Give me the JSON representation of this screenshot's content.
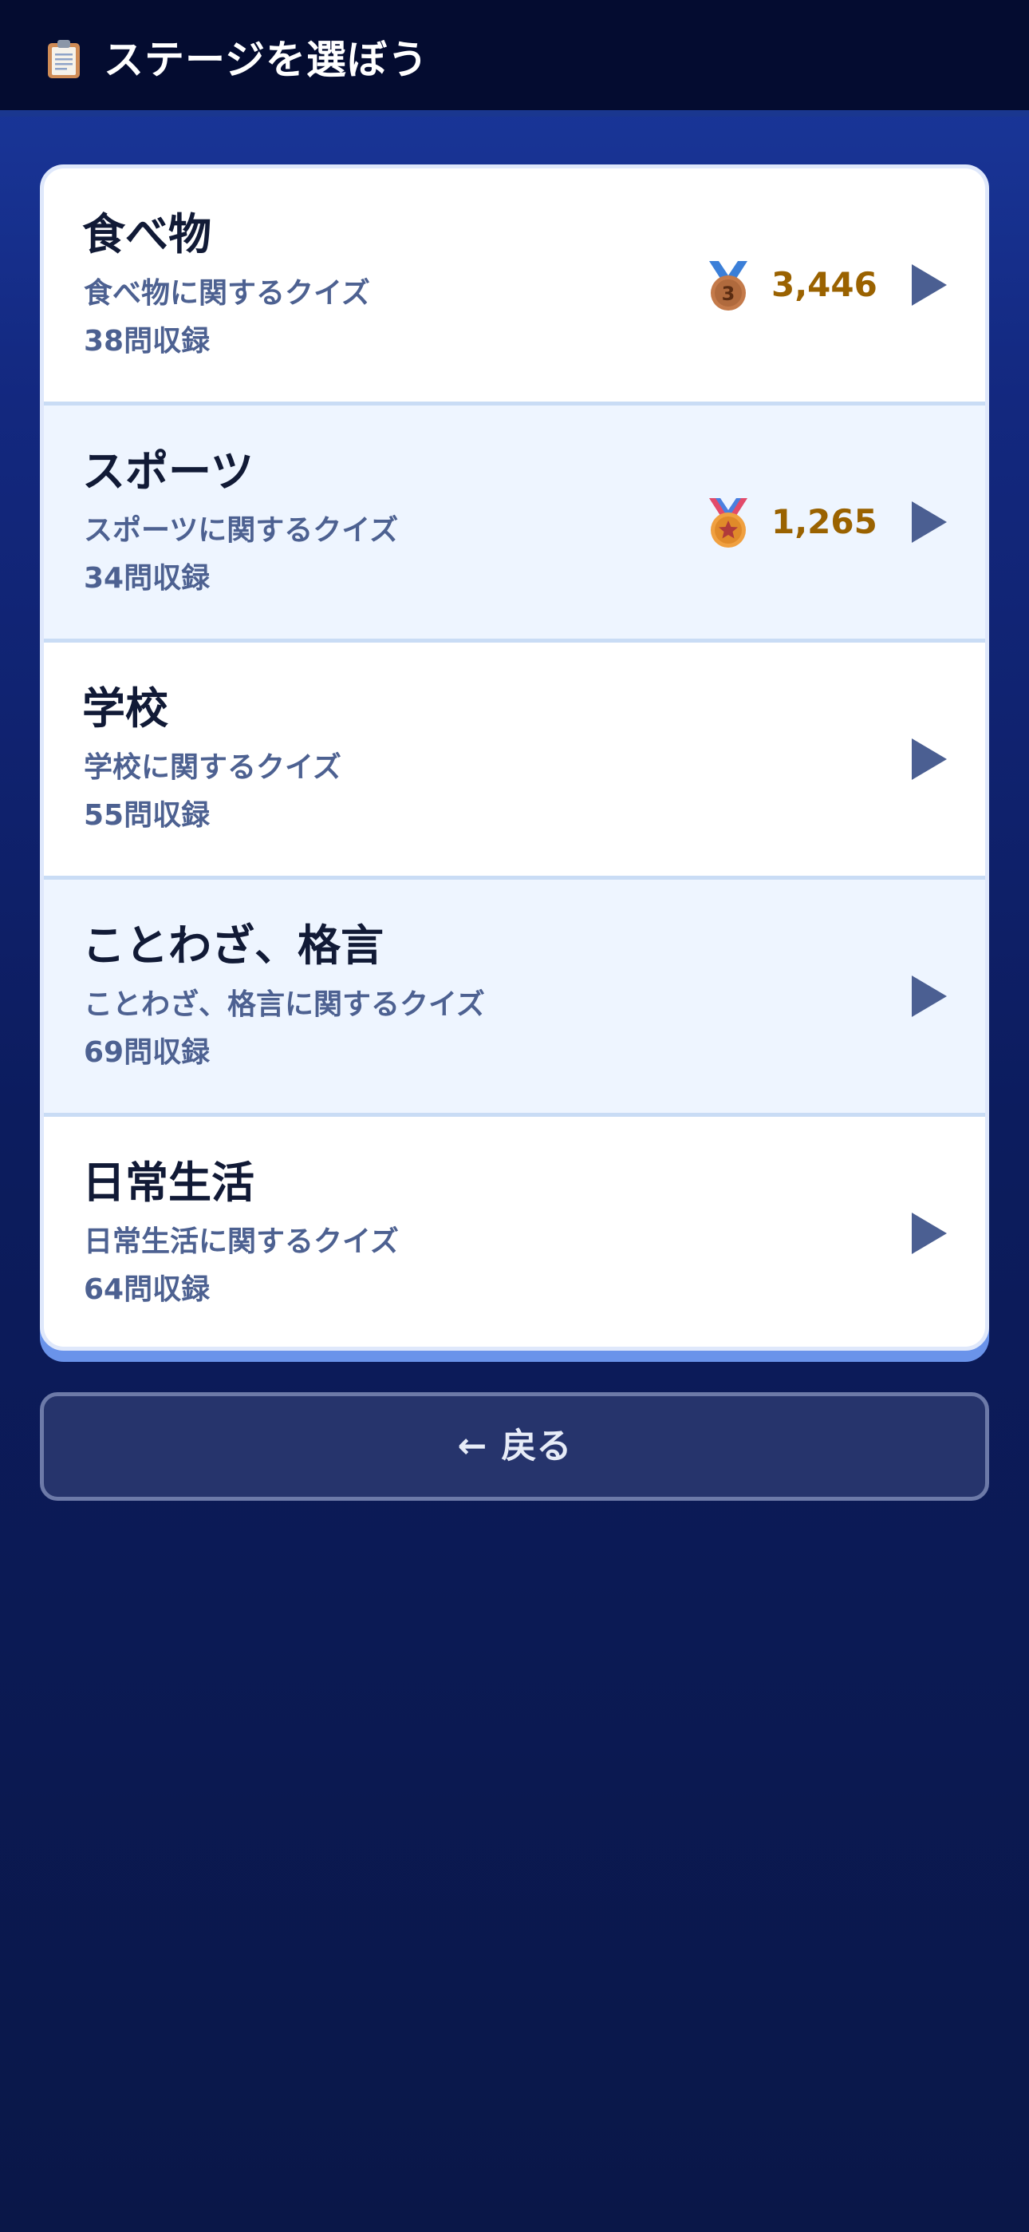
{
  "header": {
    "icon": "clipboard-icon",
    "title": "ステージを選ぼう"
  },
  "stages": [
    {
      "name": "食べ物",
      "description": "食べ物に関するクイズ",
      "count": "38問収録",
      "medal": "bronze-medal-icon",
      "score": "3,446"
    },
    {
      "name": "スポーツ",
      "description": "スポーツに関するクイズ",
      "count": "34問収録",
      "medal": "star-medal-icon",
      "score": "1,265"
    },
    {
      "name": "学校",
      "description": "学校に関するクイズ",
      "count": "55問収録"
    },
    {
      "name": "ことわざ、格言",
      "description": "ことわざ、格言に関するクイズ",
      "count": "69問収録"
    },
    {
      "name": "日常生活",
      "description": "日常生活に関するクイズ",
      "count": "64問収録"
    }
  ],
  "back_button": {
    "arrow": "←",
    "label": "戻る"
  },
  "colors": {
    "header_bg": "#040c30",
    "page_bg": "#13287f",
    "card_bg": "#ffffff",
    "alt_row_bg": "#eef5ff",
    "title_text": "#111a36",
    "sub_text": "#4d6191",
    "score_text": "#9a6200",
    "arrow": "#4b5f92"
  }
}
